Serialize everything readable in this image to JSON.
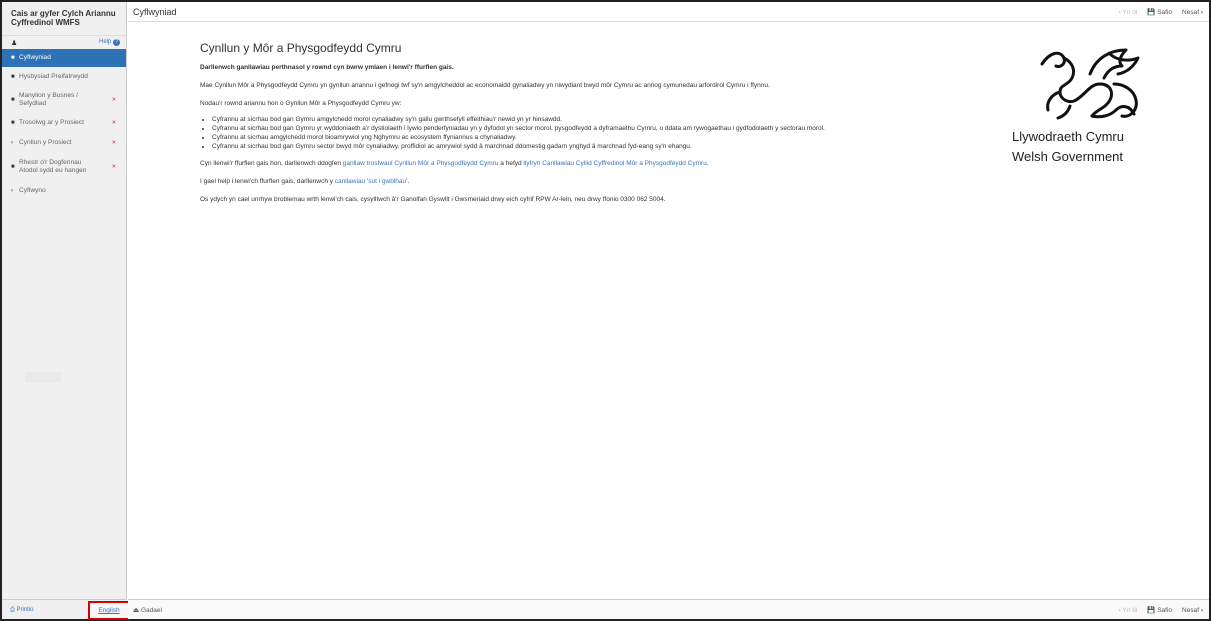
{
  "sidebar": {
    "title": "Cais ar gyfer Cylch Ariannu Cyffredinol WMFS",
    "help": "Help",
    "items": [
      {
        "label": "Cyflwyniad",
        "icon": "document-icon",
        "active": true,
        "error": false
      },
      {
        "label": "Hysbysiad Preifatrwydd",
        "icon": "document-icon",
        "active": false,
        "error": false
      },
      {
        "label": "Manylion y Busnes / Sefydliad",
        "icon": "document-icon",
        "active": false,
        "error": true
      },
      {
        "label": "Trosolwg ar y Prosiect",
        "icon": "document-icon",
        "active": false,
        "error": true
      },
      {
        "label": "Cynllun y Prosiect",
        "icon": "chevron-right-icon",
        "active": false,
        "error": true
      },
      {
        "label": "Rhestr o'r Dogfennau Atodol sydd eu hangen",
        "icon": "document-icon",
        "active": false,
        "error": true
      },
      {
        "label": "Cyflwyno",
        "icon": "chevron-right-icon",
        "active": false,
        "error": false
      }
    ],
    "print": "Printio",
    "english": "English"
  },
  "header": {
    "title": "Cyflwyniad",
    "prev": "Yn ôl",
    "save": "Safio",
    "next": "Nesaf"
  },
  "footer": {
    "leave": "Gadael",
    "prev": "Yn ôl",
    "save": "Safio",
    "next": "Nesaf"
  },
  "content": {
    "heading": "Cynllun y Môr a Physgodfeydd Cymru",
    "intro_bold": "Darllenwch ganllawiau perthnasol y rownd cyn bwrw ymlaen i lenwi'r ffurflen gais.",
    "para1": "Mae Cynllun Môr a Physgodfeydd Cymru yn gynllun ariannu i gefnogi twf sy'n amgylcheddol ac economaidd gynaliadwy yn niwydiant bwyd môr Cymru ac annog cymunedau arfordirol Cymru i ffynnu.",
    "para2": "Nodau'r rownd ariannu hon o Gynllun Môr a Physgodfeydd Cymru yw:",
    "bullets": [
      "Cyfrannu at sicrhau bod gan Gymru amgylchedd morol cynaliadwy sy'n gallu gwrthsefyll effeithiau'r newid yn yr hinsawdd.",
      "Cyfrannu at sicrhau bod gan Gymru yr wyddoniaeth a'r dystiolaeth i lywio penderfyniadau yn y dyfodol yn sector morol, pysgodfeydd a dyframaethu Cymru, o ddata am rywogaethau i gydfodolaeth y sectorau morol.",
      "Cyfrannu at sicrhau amgylchedd morol bioamrywiol yng Nghymru ac ecosystem ffyniannus a chynaliadwy.",
      "Cyfrannu at sicrhau bod gan Gymru sector bwyd môr cynaliadwy, proffidiol ac amrywiol sydd â marchnad ddomestig gadarn ynghyd â marchnad fyd-eang sy'n ehangu."
    ],
    "para3_a": "Cyn llenwi'r ffurflen gais hon, darllenwch ddogfen ",
    "para3_link1": "ganllaw trosfwaol Cynllun Môr a Physgodfeydd Cymru",
    "para3_b": " a hefyd ",
    "para3_link2": "llyfryn Canllawiau Cyllid Cyffredinol Môr a Physgodfeydd Cymru",
    "para3_c": ".",
    "para4_a": "I gael help i lenwi'ch ffurflen gais, darllenwch y ",
    "para4_link": "canllawiau 'sut i gwblhau'",
    "para4_b": ".",
    "para5": "Os ydych yn cael unrhyw broblemau wrth lenwi'ch cais, cysylltwch â'r Ganolfan Gyswllt i Gwsmeriaid drwy eich cyfrif RPW Ar-lein, neu drwy ffonio 0300 062 5004."
  },
  "logo": {
    "line1": "Llywodraeth Cymru",
    "line2": "Welsh Government"
  },
  "colors": {
    "accent": "#2e72b5",
    "link": "#3b73b9",
    "error": "#c0392b",
    "highlight_border": "#d40000"
  }
}
